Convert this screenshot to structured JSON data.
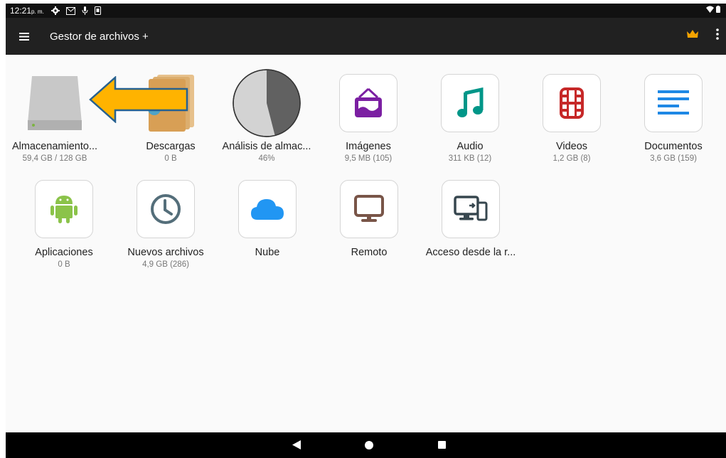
{
  "status_bar": {
    "time": "12:21",
    "ampm": "p. m.",
    "icons": [
      "settings-icon",
      "gmail-icon",
      "microphone-icon",
      "screenshot-icon"
    ],
    "right_icons": [
      "wifi-icon",
      "battery-icon"
    ]
  },
  "app_bar": {
    "title": "Gestor de archivos +",
    "menu_icon": "hamburger-menu-icon",
    "premium_icon": "crown-icon",
    "more_icon": "more-vert-icon",
    "crown_color": "#f4a300"
  },
  "tiles": [
    {
      "label": "Almacenamiento...",
      "sub": "59,4 GB / 128 GB",
      "icon": "hard-drive-icon"
    },
    {
      "label": "Descargas",
      "sub": "0 B",
      "icon": "downloads-folder-icon"
    },
    {
      "label": "Análisis de almac...",
      "sub": "46%",
      "icon": "pie-chart-icon",
      "value": 0.46
    },
    {
      "label": "Imágenes",
      "sub": "9,5 MB (105)",
      "icon": "image-frame-icon",
      "color": "#7b1fa2"
    },
    {
      "label": "Audio",
      "sub": "311 KB (12)",
      "icon": "music-note-icon",
      "color": "#009688"
    },
    {
      "label": "Videos",
      "sub": "1,2 GB (8)",
      "icon": "film-strip-icon",
      "color": "#c62828"
    },
    {
      "label": "Documentos",
      "sub": "3,6 GB (159)",
      "icon": "document-lines-icon",
      "color": "#1e88e5"
    },
    {
      "label": "Aplicaciones",
      "sub": "0 B",
      "icon": "android-icon",
      "color": "#8bc34a"
    },
    {
      "label": "Nuevos archivos",
      "sub": "4,9 GB (286)",
      "icon": "clock-icon",
      "color": "#546e7a"
    },
    {
      "label": "Nube",
      "sub": "",
      "icon": "cloud-icon",
      "color": "#2196f3"
    },
    {
      "label": "Remoto",
      "sub": "",
      "icon": "monitor-icon",
      "color": "#795548"
    },
    {
      "label": "Acceso desde la r...",
      "sub": "",
      "icon": "remote-access-icon",
      "color": "#37474f"
    }
  ],
  "overlay": {
    "icon": "arrow-left-icon",
    "color": "#ffb300"
  },
  "nav_bar": {
    "back_icon": "back-triangle-icon",
    "home_icon": "home-circle-icon",
    "recent_icon": "recent-square-icon"
  }
}
